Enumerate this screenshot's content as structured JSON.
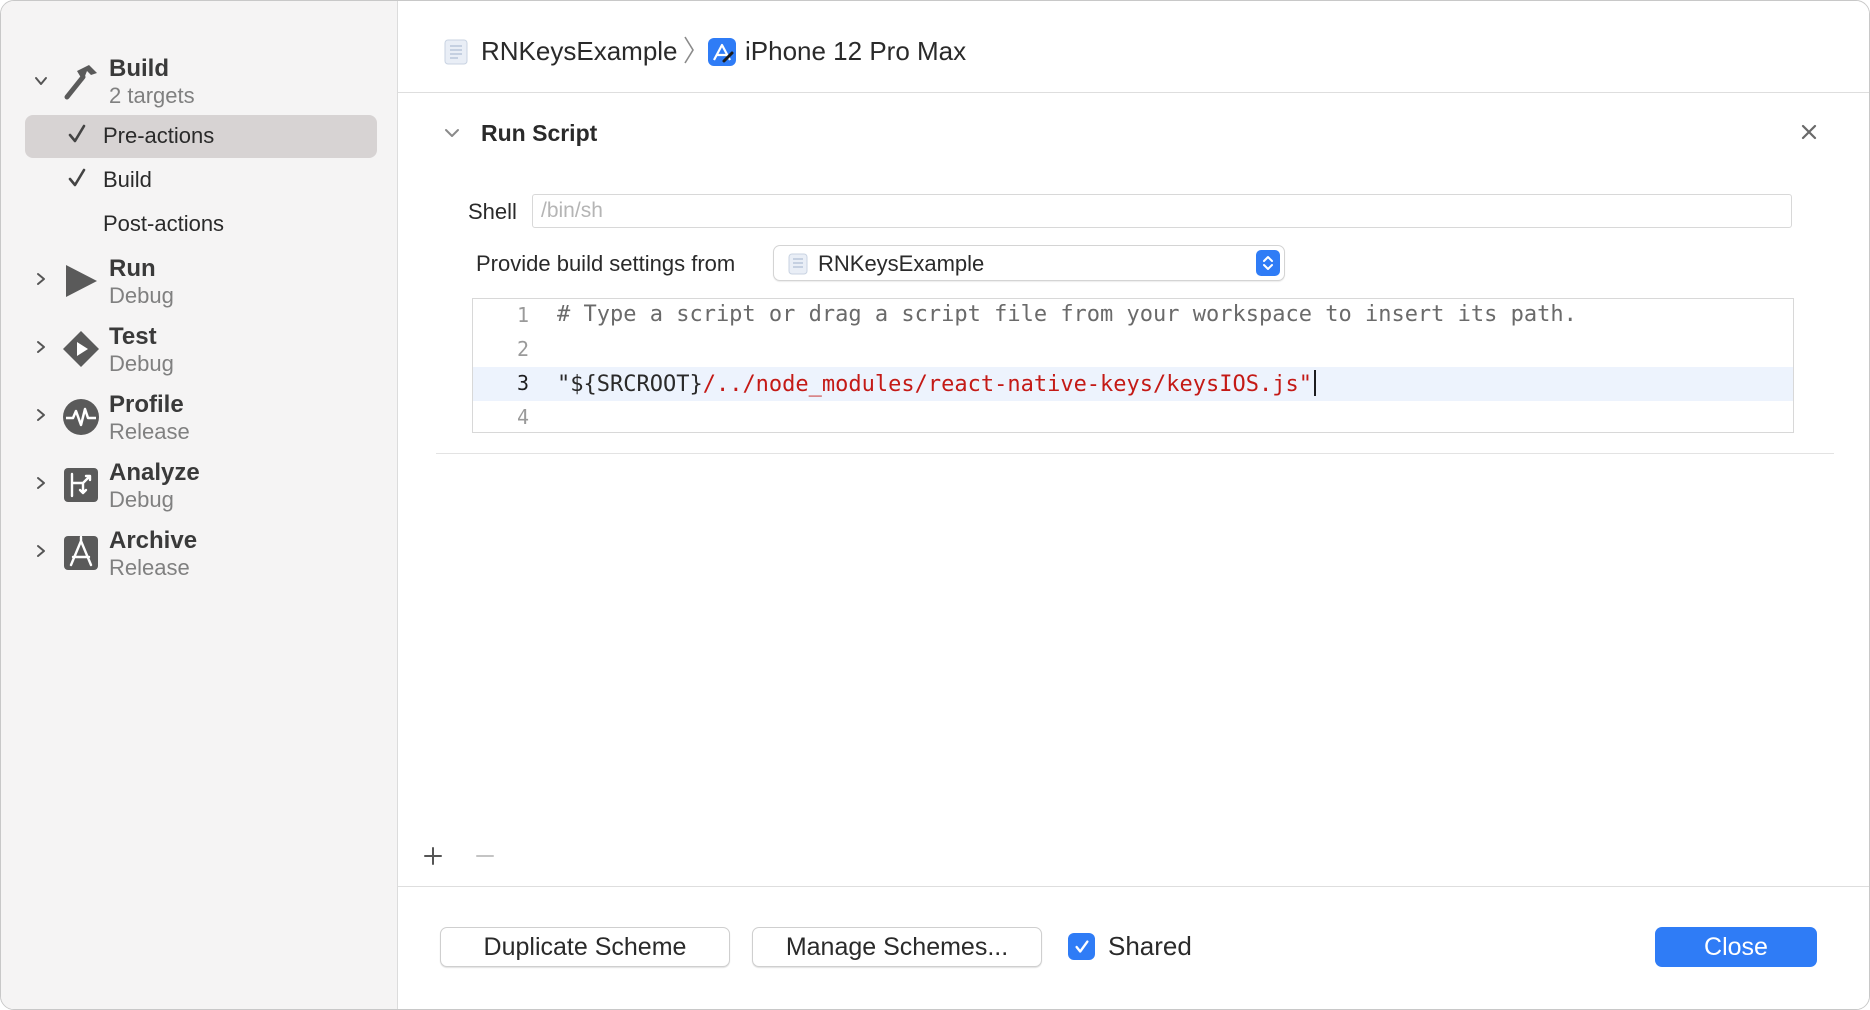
{
  "sidebar": {
    "actions": [
      {
        "title": "Build",
        "subtitle": "2 targets",
        "icon": "hammer-icon",
        "expanded": true
      },
      {
        "title": "Run",
        "subtitle": "Debug",
        "icon": "play-icon"
      },
      {
        "title": "Test",
        "subtitle": "Debug",
        "icon": "test-diamond-icon"
      },
      {
        "title": "Profile",
        "subtitle": "Release",
        "icon": "profile-waveform-icon"
      },
      {
        "title": "Analyze",
        "subtitle": "Debug",
        "icon": "analyze-icon"
      },
      {
        "title": "Archive",
        "subtitle": "Release",
        "icon": "archive-icon"
      }
    ],
    "build_phases": [
      {
        "label": "Pre-actions",
        "checked": true,
        "selected": true
      },
      {
        "label": "Build",
        "checked": true,
        "selected": false
      },
      {
        "label": "Post-actions",
        "checked": false,
        "selected": false
      }
    ]
  },
  "breadcrumb": {
    "project": "RNKeysExample",
    "device": "iPhone 12 Pro Max"
  },
  "run_script": {
    "title": "Run Script",
    "shell_label": "Shell",
    "shell_value": "",
    "shell_placeholder": "/bin/sh",
    "build_settings_label": "Provide build settings from",
    "build_settings_value": "RNKeysExample",
    "lines": [
      {
        "number": "1",
        "text": "# Type a script or drag a script file from your workspace to insert its path."
      },
      {
        "number": "2",
        "text": ""
      },
      {
        "number": "3",
        "prefix": "\"${SRCROOT}",
        "path": "/../node_modules/react-native-keys/keysIOS.js\""
      },
      {
        "number": "4",
        "text": ""
      }
    ]
  },
  "footer": {
    "duplicate_label": "Duplicate Scheme",
    "manage_label": "Manage Schemes...",
    "shared_label": "Shared",
    "shared_checked": true,
    "close_label": "Close"
  },
  "colors": {
    "accent": "#2f7cf6",
    "selection": "#d7d3d3",
    "string": "#c41a16",
    "current_line": "#edf3fd"
  }
}
